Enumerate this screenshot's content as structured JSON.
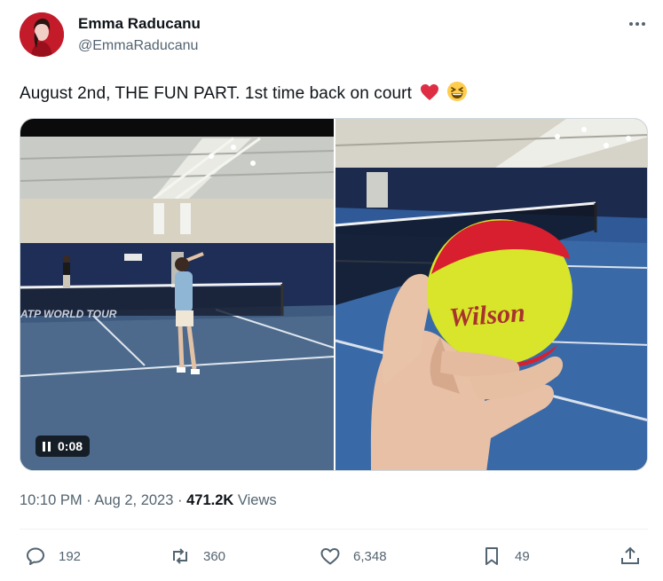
{
  "author": {
    "display_name": "Emma Raducanu",
    "handle": "@EmmaRaducanu",
    "avatar_icon": "profile-photo"
  },
  "tweet": {
    "text": "August 2nd, THE FUN PART. 1st time back on court",
    "emojis": [
      "red-heart-emoji",
      "grinning-squinting-face-emoji"
    ]
  },
  "media": {
    "video_time": "0:08",
    "video_state": "pause-icon",
    "left_banner_text": "ATP WORLD TOUR",
    "ball_brand": "Wilson"
  },
  "meta": {
    "time": "10:10 PM",
    "separator": "·",
    "date": "Aug 2, 2023",
    "views_count": "471.2K",
    "views_label": "Views"
  },
  "actions": {
    "replies": "192",
    "reposts": "360",
    "likes": "6,348",
    "bookmarks": "49"
  },
  "colors": {
    "text_primary": "#0f1419",
    "text_secondary": "#536471",
    "court_blue": "#3a5f8f",
    "ball_yellow": "#d6e82b",
    "ball_red": "#d81f2f"
  }
}
